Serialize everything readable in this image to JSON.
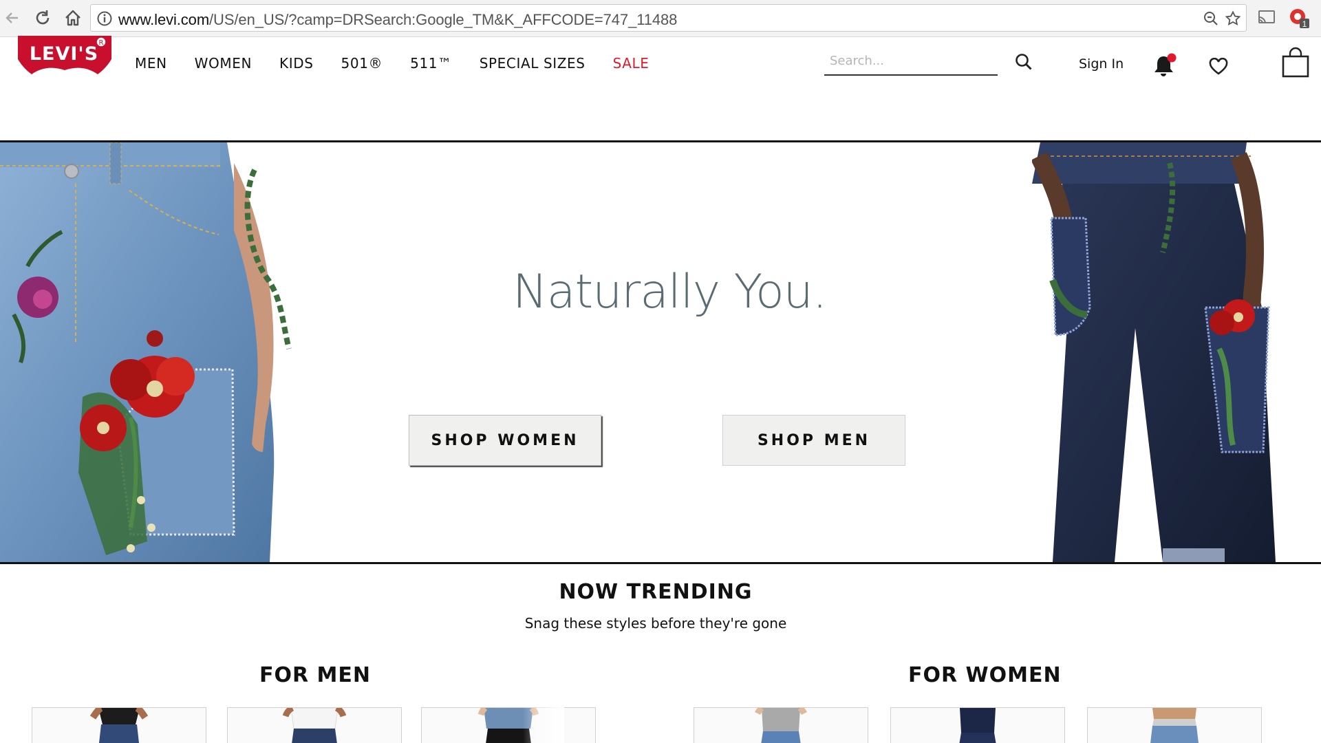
{
  "browser": {
    "url_host": "www.levi.com",
    "url_path": "/US/en_US/?camp=DRSearch:Google_TM&K_AFFCODE=747_11488",
    "extension_badge": "1"
  },
  "header": {
    "logo_text": "LEVI'S",
    "nav": [
      {
        "label": "MEN"
      },
      {
        "label": "WOMEN"
      },
      {
        "label": "KIDS"
      },
      {
        "label": "501®"
      },
      {
        "label": "511™"
      },
      {
        "label": "SPECIAL SIZES"
      },
      {
        "label": "SALE"
      }
    ],
    "search_placeholder": "Search...",
    "sign_in": "Sign In"
  },
  "hero": {
    "headline": "Naturally You.",
    "shop_women": "SHOP WOMEN",
    "shop_men": "SHOP MEN"
  },
  "trending": {
    "title": "NOW TRENDING",
    "subtitle": "Snag these styles before they're gone",
    "for_men": "FOR MEN",
    "for_women": "FOR WOMEN"
  },
  "colors": {
    "brand_red": "#c8102e",
    "sale_red": "#e1192c",
    "headline_gray": "#5b6b72",
    "light_denim": "#6b93bd",
    "dark_denim": "#1d2740",
    "poppy_red": "#c21a1a",
    "leaf_green": "#3b6e3a"
  },
  "icons": [
    "back-arrow-icon",
    "reload-icon",
    "home-icon",
    "info-icon",
    "zoom-icon",
    "star-icon",
    "cast-icon",
    "extension-icon",
    "search-icon",
    "bell-icon",
    "heart-icon",
    "shopping-bag-icon"
  ]
}
